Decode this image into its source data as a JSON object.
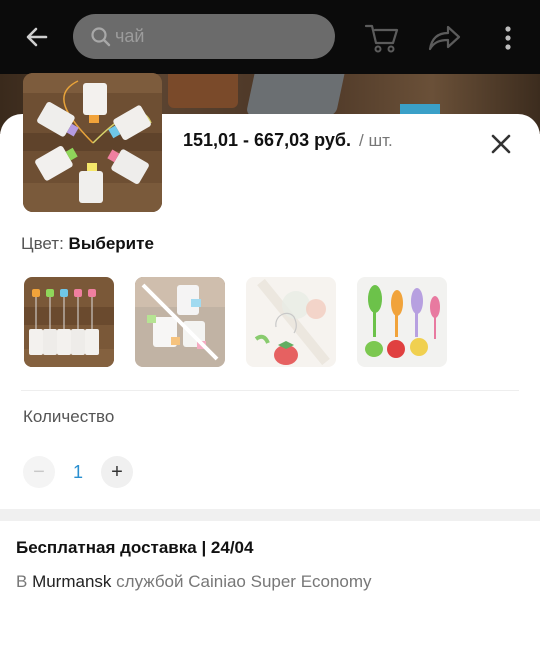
{
  "header": {
    "search_placeholder": "чай",
    "icons": [
      "back-arrow-icon",
      "search-icon",
      "cart-icon",
      "share-icon",
      "more-vert-icon"
    ]
  },
  "product": {
    "price_range": "151,01 - 667,03 руб.",
    "unit": "/ шт.",
    "close_icon": "close-icon"
  },
  "color": {
    "label": "Цвет: ",
    "value": "Выберите"
  },
  "variants": [
    {
      "name": "variant-row-leaves"
    },
    {
      "name": "variant-leaf-bags-unavailable"
    },
    {
      "name": "variant-strawberry"
    },
    {
      "name": "variant-figures"
    }
  ],
  "quantity": {
    "label": "Количество",
    "value": "1",
    "minus": "−",
    "plus": "+"
  },
  "delivery": {
    "title": "Бесплатная доставка | 24/04",
    "prefix": "В ",
    "city": "Murmansk",
    "service": " службой Cainiao Super Economy"
  },
  "colors": {
    "header_bg": "#0b0b0b",
    "search_bg": "#6b6b6b",
    "accent_qty": "#2a8fd0"
  }
}
